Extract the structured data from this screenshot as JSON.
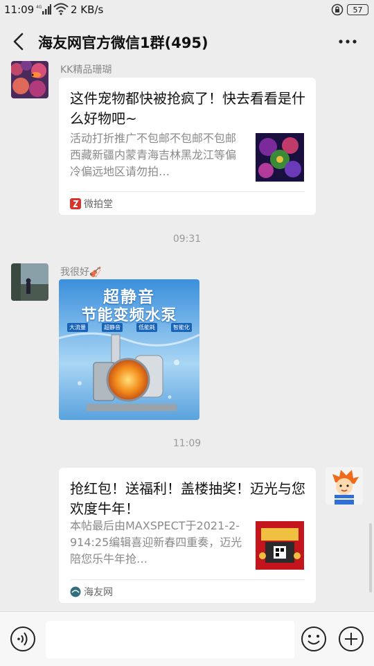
{
  "status_bar": {
    "time": "11:09",
    "network": "4G",
    "speed": "2 KB/s",
    "battery": "57"
  },
  "header": {
    "title": "海友网官方微信1群(495)"
  },
  "messages": [
    {
      "sender": "KK精品珊瑚",
      "type": "link-card",
      "title": "这件宠物都快被抢疯了！快去看看是什么好物吧~",
      "description": "活动打折推广不包邮不包邮不包邮西藏新疆内蒙青海吉林黑龙江等偏冷偏远地区请勿拍…",
      "source": "微拍堂",
      "source_color": "#d8342b"
    },
    {
      "type": "timestamp",
      "text": "09:31"
    },
    {
      "sender": "我很好🎻",
      "type": "image",
      "image_text": {
        "line1": "超静音",
        "line2": "节能变频水泵",
        "tags": [
          "大流量",
          "超静音",
          "低能耗",
          "智能化"
        ]
      }
    },
    {
      "type": "timestamp",
      "text": "11:09"
    },
    {
      "sender": "",
      "type": "link-card",
      "title": "抢红包！送福利！盖楼抽奖！迈光与您欢度牛年！",
      "description": "本帖最后由MAXSPECT于2021-2-914:25编辑喜迎新春四重奏，迈光陪您乐牛年抢…",
      "source": "海友网",
      "source_color": "#2f6f7e"
    }
  ],
  "input_bar": {
    "placeholder": ""
  },
  "icons": [
    "back-arrow-icon",
    "more-icon",
    "voice-icon",
    "emoji-icon",
    "plus-icon",
    "wifi-icon",
    "signal-icon",
    "alarm-icon",
    "battery-icon"
  ],
  "colors": {
    "background": "#ededed",
    "card": "#ffffff",
    "meta_text": "#888888"
  }
}
